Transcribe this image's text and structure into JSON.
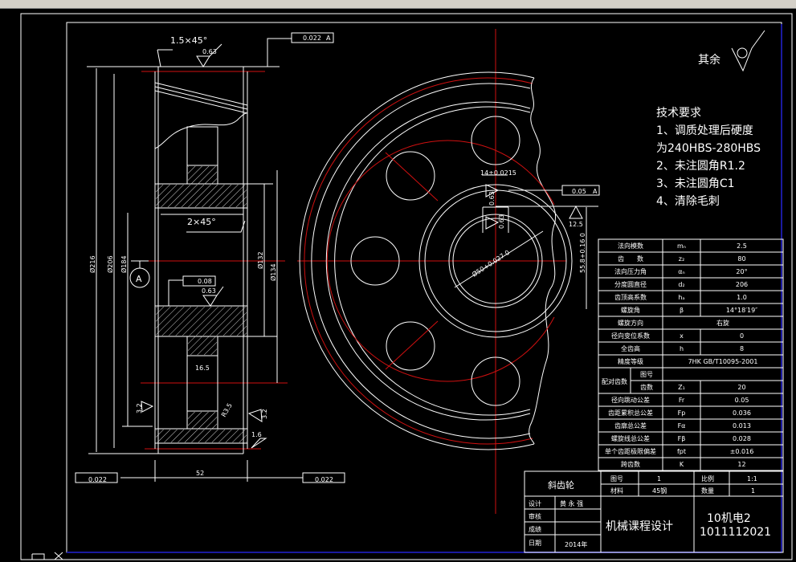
{
  "colors": {
    "background": "#000000",
    "lines": "#ffffff",
    "centerlines": "#d01010",
    "frame_accent": "#1a1aa0",
    "toolbar": "#d4d0c8"
  },
  "side_view": {
    "chamfer_top": "1.5×45°",
    "roughness_top": "0.63",
    "runout_top": "0.022",
    "datum_ref": "A",
    "chamfer_hub": "2×45°",
    "flatness_tol": "0.08",
    "roughness_hub": "0.63",
    "datum_label": "A",
    "web_width": "16.5",
    "fillet": "R3.5",
    "roughness_left": "3.2",
    "roughness_right": "3.2",
    "roughness_bottom": "1.6",
    "width": "52",
    "runout_bottom_left": "0.022",
    "runout_bottom_right": "0.022",
    "dia_216": "Ø216",
    "dia_206": "Ø206",
    "dia_184": "Ø184",
    "dia_132": "Ø132",
    "dia_134": "Ø134"
  },
  "front_view": {
    "keyway_width": "14±0.0215",
    "keyway_rough1": "0.63",
    "keyway_rough2": "0.63",
    "symmetry_tol": "0.05",
    "symmetry_datum": "A",
    "roughness_keyway": "12.5",
    "keyway_depth": "55.8+0.16 0",
    "bore": "Ø50+0.027 0"
  },
  "notes": {
    "other_label": "其余",
    "title": "技术要求",
    "lines": [
      "1、调质处理后硬度",
      "为240HBS-280HBS",
      "2、未注圆角R1.2",
      "3、未注圆角C1",
      "4、清除毛刺"
    ]
  },
  "param_table": {
    "rows": [
      {
        "label": "法向模数",
        "sym": "mₙ",
        "val": "2.5"
      },
      {
        "label": "齿　　数",
        "sym": "z₂",
        "val": "80"
      },
      {
        "label": "法向压力角",
        "sym": "αₙ",
        "val": "20°"
      },
      {
        "label": "分度圆直径",
        "sym": "d₂",
        "val": "206"
      },
      {
        "label": "齿顶高系数",
        "sym": "hₐ",
        "val": "1.0"
      },
      {
        "label": "螺旋角",
        "sym": "β",
        "val": "14°18′19″"
      },
      {
        "label": "螺旋方向",
        "sym": "",
        "val": "右旋"
      },
      {
        "label": "径向变位系数",
        "sym": "x",
        "val": "0"
      },
      {
        "label": "全齿高",
        "sym": "h",
        "val": "8"
      },
      {
        "label": "精度等级",
        "sym": "",
        "val": "7HK GB/T10095-2001"
      }
    ],
    "pair": {
      "label": "配对齿数",
      "sub1": "图号",
      "sub2": "齿数",
      "sym": "Z₁",
      "val": "20"
    },
    "tol_rows": [
      {
        "label": "径向跳动公差",
        "sym": "Fr",
        "val": "0.05"
      },
      {
        "label": "齿距累积总公差",
        "sym": "Fp",
        "val": "0.036"
      },
      {
        "label": "齿廓总公差",
        "sym": "Fα",
        "val": "0.013"
      },
      {
        "label": "螺旋线总公差",
        "sym": "Fβ",
        "val": "0.028"
      },
      {
        "label": "单个齿距极限偏差",
        "sym": "fpt",
        "val": "±0.016"
      },
      {
        "label": "跨齿数",
        "sym": "K",
        "val": "12"
      }
    ]
  },
  "title_block": {
    "part_name": "斜齿轮",
    "drawing_no_label": "图号",
    "drawing_no": "1",
    "scale_label": "比例",
    "scale": "1:1",
    "material_label": "材料",
    "material": "45钢",
    "qty_label": "数量",
    "qty": "1",
    "designer_label": "设计",
    "designer": "黄 永 强",
    "review_label": "审核",
    "grade_label": "成绩",
    "date_label": "日期",
    "date": "2014年",
    "course": "机械课程设计",
    "class": "10机电2",
    "student_id": "1011112021"
  }
}
